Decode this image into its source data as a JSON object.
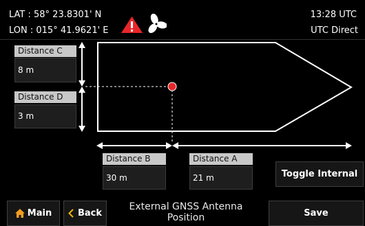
{
  "status": {
    "lat": "LAT : 58° 23.8301' N",
    "lon": "LON : 015° 41.9621' E",
    "time": "13:28 UTC",
    "time_mode": "UTC Direct"
  },
  "icons": {
    "warning": "warning-triangle-icon",
    "fan": "fan-icon",
    "home": "home-icon",
    "back": "chevron-left-icon"
  },
  "colors": {
    "warning": "#e8262a",
    "antenna": "#e8262a",
    "home": "#f29d1f",
    "back": "#f2b705"
  },
  "distances": {
    "c": {
      "label": "Distance C",
      "value": "8 m"
    },
    "d": {
      "label": "Distance D",
      "value": "3 m"
    },
    "b": {
      "label": "Distance B",
      "value": "30 m"
    },
    "a": {
      "label": "Distance A",
      "value": "21 m"
    }
  },
  "buttons": {
    "toggle": "Toggle Internal",
    "main": "Main",
    "back": "Back",
    "save": "Save"
  },
  "footer": {
    "title": "External GNSS Antenna Position"
  }
}
